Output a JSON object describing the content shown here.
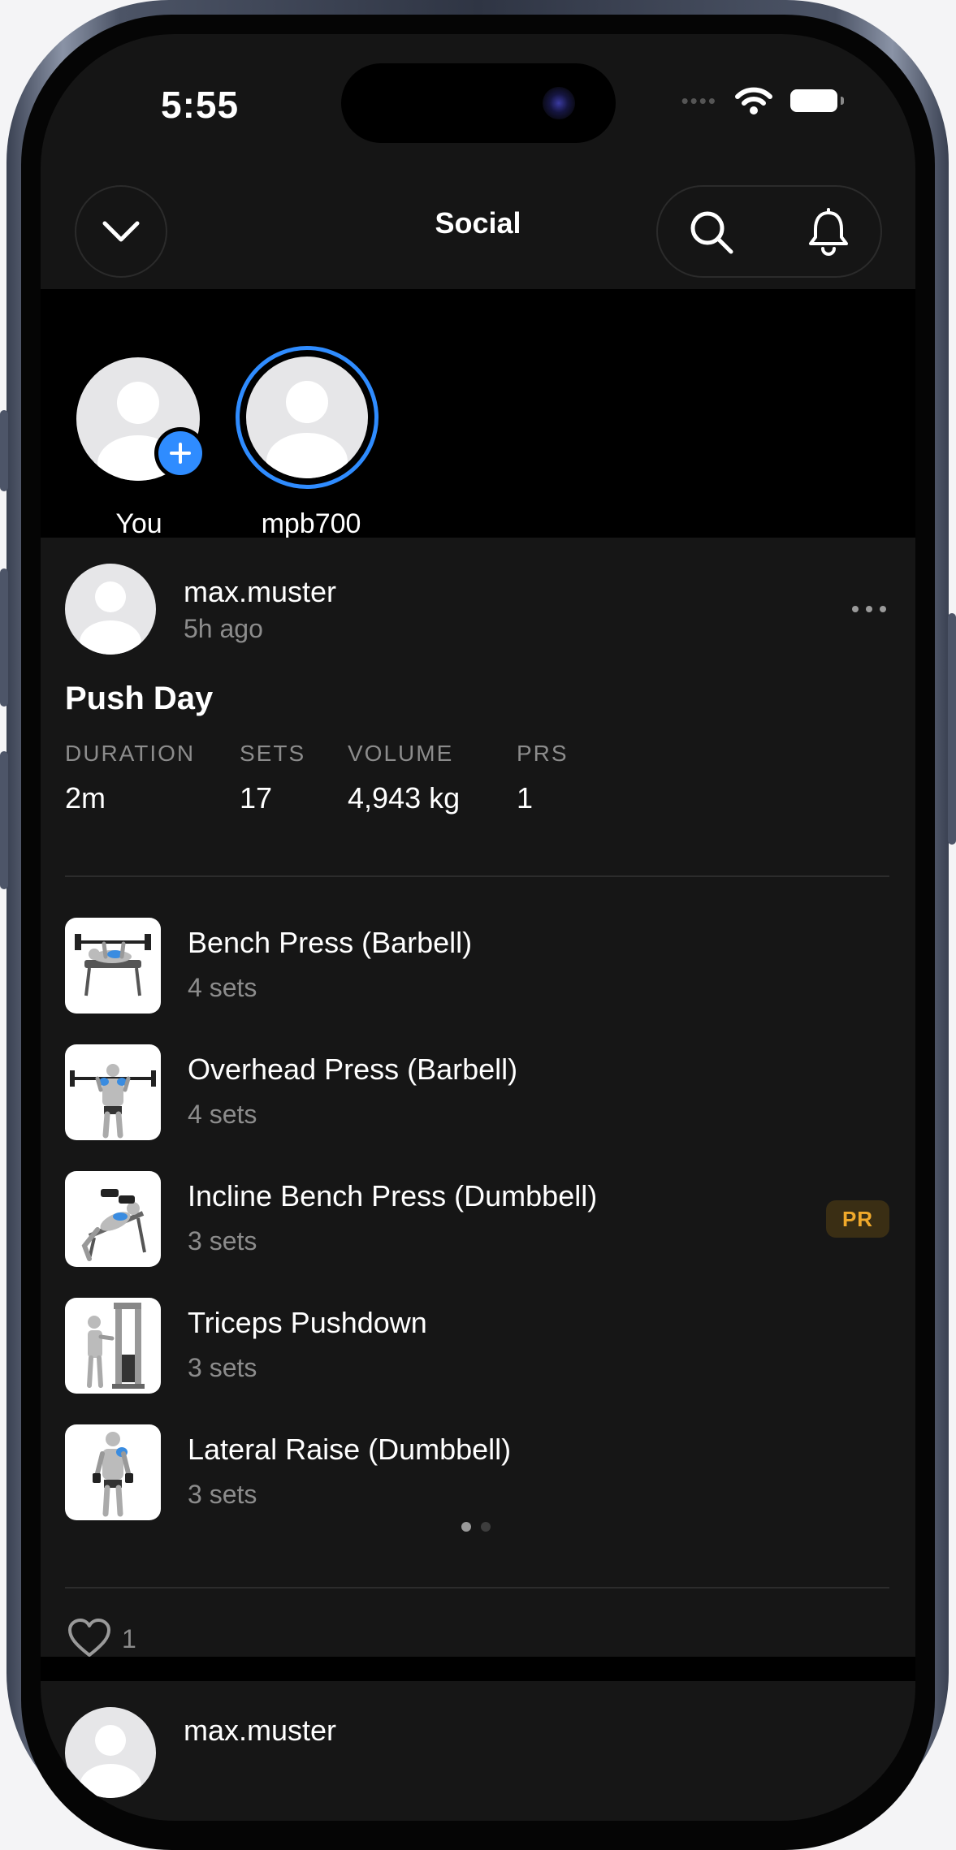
{
  "status_bar": {
    "time": "5:55",
    "signal_icon": "signal-dots-icon",
    "wifi_icon": "wifi-icon",
    "battery_icon": "battery-icon"
  },
  "header": {
    "title": "Social",
    "back_icon": "chevron-down-icon",
    "search_icon": "search-icon",
    "notifications_icon": "bell-icon"
  },
  "stories": [
    {
      "label": "You",
      "badge_icon": "plus-icon"
    },
    {
      "label": "mpb700"
    }
  ],
  "post": {
    "username": "max.muster",
    "time_ago": "5h ago",
    "more_icon": "ellipsis-icon",
    "workout_title": "Push Day",
    "stats": [
      {
        "label": "DURATION",
        "value": "2m"
      },
      {
        "label": "SETS",
        "value": "17"
      },
      {
        "label": "VOLUME",
        "value": "4,943 kg"
      },
      {
        "label": "PRS",
        "value": "1"
      }
    ],
    "exercises": [
      {
        "name": "Bench Press (Barbell)",
        "sets": "4 sets"
      },
      {
        "name": "Overhead Press (Barbell)",
        "sets": "4 sets"
      },
      {
        "name": "Incline Bench Press (Dumbbell)",
        "sets": "3 sets",
        "badge": "PR"
      },
      {
        "name": "Triceps Pushdown",
        "sets": "3 sets"
      },
      {
        "name": "Lateral Raise (Dumbbell)",
        "sets": "3 sets"
      }
    ],
    "pager": {
      "current": 1,
      "total": 2
    },
    "like_icon": "heart-icon",
    "likes": "1"
  },
  "next_post": {
    "username": "max.muster"
  },
  "colors": {
    "accent_blue": "#2f8cff",
    "pr_text": "#f0a92b",
    "pr_bg": "#3a2e14",
    "card_bg": "#161616"
  }
}
